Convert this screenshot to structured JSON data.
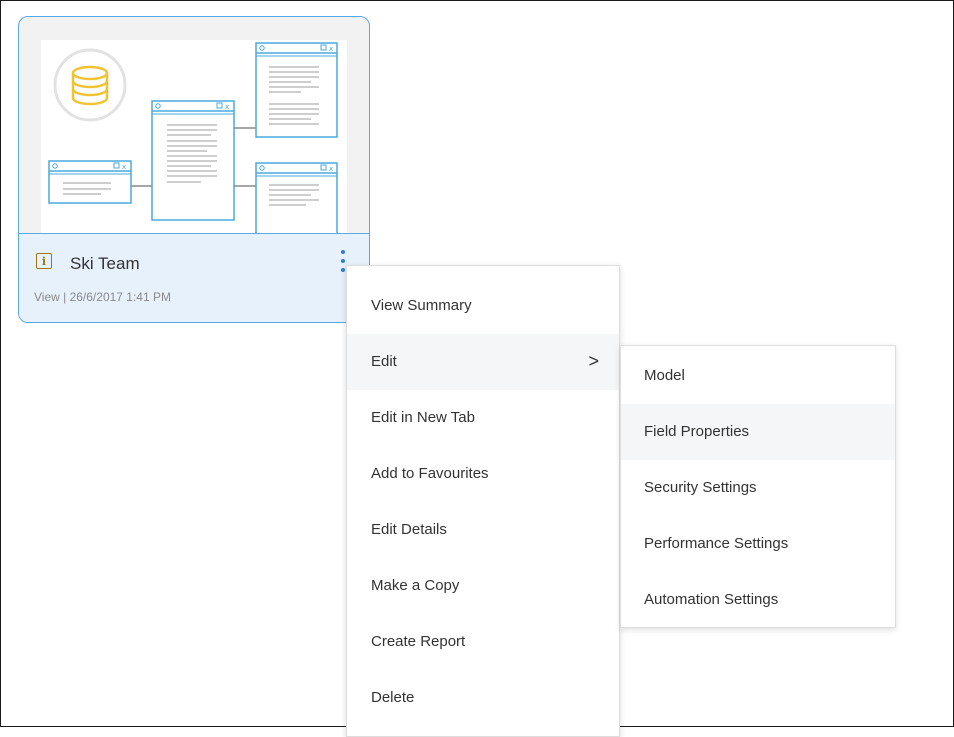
{
  "card": {
    "title": "Ski Team",
    "meta": "View | 26/6/2017 1:41 PM",
    "type_icon": "info-icon",
    "thumbnail_icon": "database-icon",
    "menu_icon": "kebab-icon"
  },
  "context_menu": {
    "items": [
      {
        "label": "View Summary"
      },
      {
        "label": "Edit",
        "has_submenu": true,
        "chevron": ">"
      },
      {
        "label": "Edit in New Tab"
      },
      {
        "label": "Add to Favourites"
      },
      {
        "label": "Edit Details"
      },
      {
        "label": "Make a Copy"
      },
      {
        "label": "Create Report"
      },
      {
        "label": "Delete"
      }
    ]
  },
  "submenu": {
    "items": [
      {
        "label": "Model"
      },
      {
        "label": "Field Properties"
      },
      {
        "label": "Security Settings"
      },
      {
        "label": "Performance Settings"
      },
      {
        "label": "Automation Settings"
      }
    ]
  },
  "colors": {
    "accent": "#5aa8e6",
    "card_footer": "#e7f1fb",
    "kebab": "#2a7fcf",
    "db_icon": "#f2c230",
    "info_icon": "#9a7a0e"
  }
}
